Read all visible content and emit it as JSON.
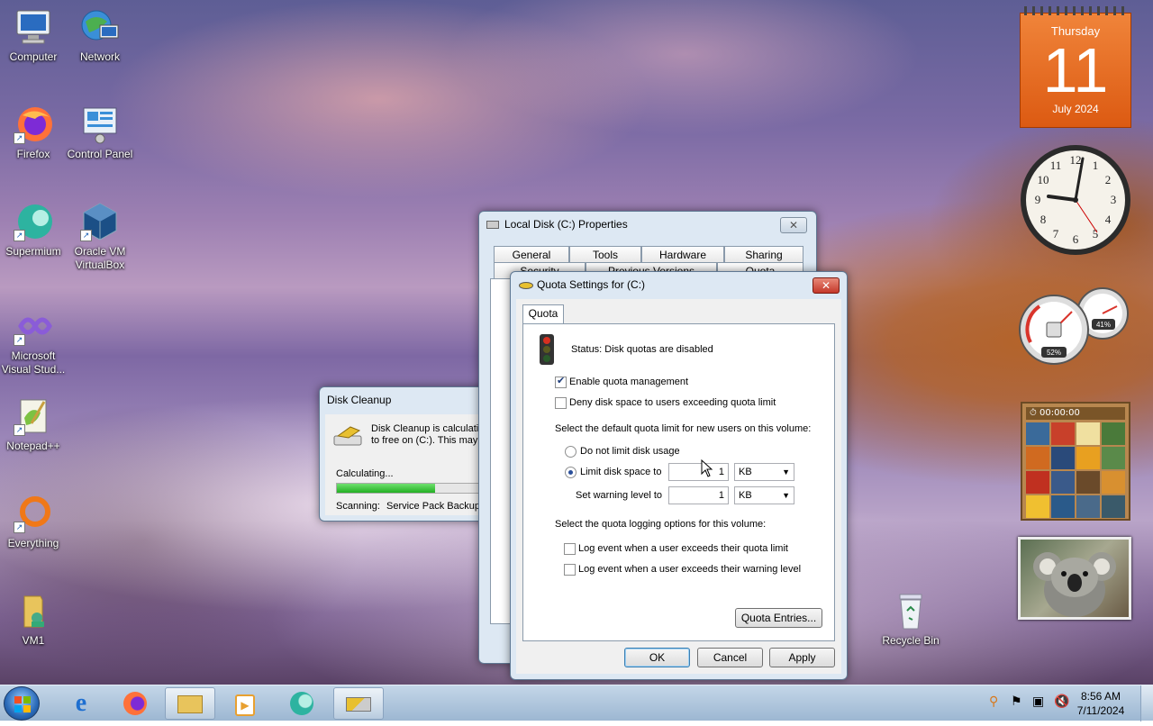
{
  "desktop_icons": [
    {
      "label": "Computer",
      "icon": "computer-icon"
    },
    {
      "label": "Network",
      "icon": "network-icon"
    },
    {
      "label": "Firefox",
      "icon": "firefox-icon"
    },
    {
      "label": "Control Panel",
      "icon": "control-panel-icon"
    },
    {
      "label": "Supermium",
      "icon": "supermium-icon"
    },
    {
      "label": "Oracle VM VirtualBox",
      "icon": "virtualbox-icon"
    },
    {
      "label": "Microsoft Visual Stud...",
      "icon": "visual-studio-icon"
    },
    {
      "label": "Notepad++",
      "icon": "notepad-plus-plus-icon"
    },
    {
      "label": "Everything",
      "icon": "everything-icon"
    },
    {
      "label": "VM1",
      "icon": "folder-icon"
    },
    {
      "label": "Recycle Bin",
      "icon": "recycle-bin-icon"
    }
  ],
  "calendar": {
    "weekday": "Thursday",
    "day": "11",
    "month_year": "July 2024"
  },
  "meter": {
    "cpu_percent": 52,
    "cpu_label": "52%",
    "mem_percent": 41,
    "mem_label": "41%"
  },
  "puzzle": {
    "timer": "00:00:00"
  },
  "disk_cleanup": {
    "title": "Disk Cleanup",
    "message": "Disk Cleanup is calculating how much space you will be able to free on  (C:). This may take a few minutes to complete.",
    "calculating": "Calculating...",
    "progress": 0.55,
    "scanning_label": "Scanning:",
    "scanning_value": "Service Pack Backup Files"
  },
  "properties": {
    "title": "Local Disk (C:) Properties",
    "tabs_row1": [
      "General",
      "Tools",
      "Hardware",
      "Sharing"
    ],
    "tabs_row2": [
      "Security",
      "Previous Versions",
      "Quota"
    ]
  },
  "quota": {
    "title": "Quota Settings for  (C:)",
    "tab": "Quota",
    "status": "Status:  Disk quotas are disabled",
    "enable_label": "Enable quota management",
    "enable_checked": true,
    "deny_label": "Deny disk space to users exceeding quota limit",
    "deny_checked": false,
    "default_limit_heading": "Select the default quota limit for new users on this volume:",
    "no_limit_label": "Do not limit disk usage",
    "limit_label": "Limit disk space to",
    "limit_value": "1",
    "limit_unit": "KB",
    "warning_label": "Set warning level to",
    "warning_value": "1",
    "warning_unit": "KB",
    "logging_heading": "Select the quota logging options for this volume:",
    "log_limit_label": "Log event when a user exceeds their quota limit",
    "log_warning_label": "Log event when a user exceeds their warning level",
    "entries_button": "Quota Entries...",
    "ok": "OK",
    "cancel": "Cancel",
    "apply": "Apply"
  },
  "taskbar": {
    "time": "8:56 AM",
    "date": "7/11/2024"
  }
}
